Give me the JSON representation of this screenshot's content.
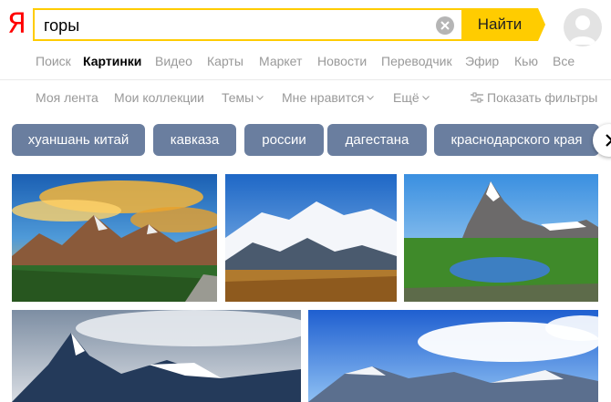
{
  "logo": "Я",
  "search": {
    "query": "горы",
    "button_label": "Найти"
  },
  "tabs": [
    {
      "label": "Поиск",
      "active": false
    },
    {
      "label": "Картинки",
      "active": true
    },
    {
      "label": "Видео",
      "active": false
    },
    {
      "label": "Карты",
      "active": false
    },
    {
      "label": "Маркет",
      "active": false
    },
    {
      "label": "Новости",
      "active": false
    },
    {
      "label": "Переводчик",
      "active": false
    },
    {
      "label": "Эфир",
      "active": false
    },
    {
      "label": "Кью",
      "active": false
    },
    {
      "label": "Все",
      "active": false
    }
  ],
  "subnav": {
    "feed": "Моя лента",
    "collections": "Мои коллекции",
    "themes": "Темы",
    "likes": "Мне нравится",
    "more": "Ещё",
    "filters": "Показать фильтры"
  },
  "chips": [
    "хуаншань китай",
    "кавказа",
    "россии",
    "дагестана",
    "краснодарского края"
  ],
  "colors": {
    "accent": "#ffcc00",
    "chip_bg": "#6a7e9f",
    "logo": "#ff0000"
  },
  "icons": {
    "clear": "close-icon",
    "next": "chevron-right-icon",
    "filters": "sliders-icon"
  }
}
